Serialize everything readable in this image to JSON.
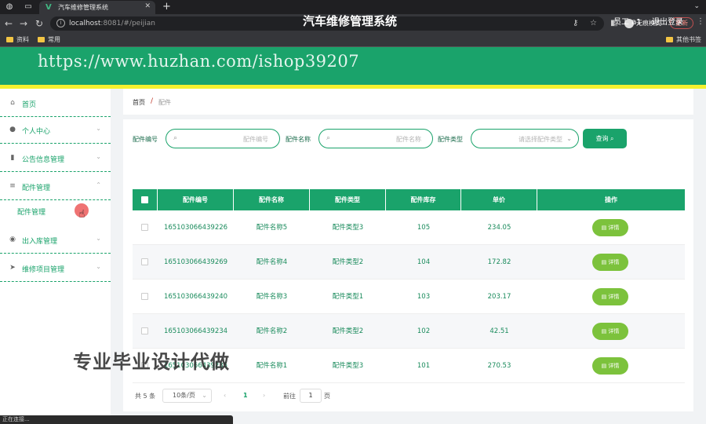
{
  "browser": {
    "tab_title": "汽车维修管理系统",
    "url_host": "localhost",
    "url_rest": ":8081/#/peijian",
    "profile_label": "无痕模式",
    "update_label": "更新",
    "bookmarks": [
      "资料",
      "常用",
      "其他书签"
    ]
  },
  "header": {
    "title": "汽车维修管理系统",
    "user": "员工 a1",
    "logout": "退出登录"
  },
  "sidebar": {
    "items": [
      {
        "label": "首页",
        "icon": "home-icon"
      },
      {
        "label": "个人中心",
        "icon": "user-icon"
      },
      {
        "label": "公告信息管理",
        "icon": "bar-chart-icon"
      },
      {
        "label": "配件管理",
        "icon": "sliders-icon"
      },
      {
        "label": "出入库管理",
        "icon": "location-icon"
      },
      {
        "label": "维修项目管理",
        "icon": "send-icon"
      }
    ],
    "sub_item": "配件管理"
  },
  "breadcrumb": {
    "home": "首页",
    "separator": "/",
    "current": "配件"
  },
  "search": {
    "fields": [
      {
        "label": "配件编号",
        "placeholder": "配件编号"
      },
      {
        "label": "配件名称",
        "placeholder": "配件名称"
      },
      {
        "label": "配件类型",
        "placeholder": "请选择配件类型"
      }
    ],
    "query_button": "查询"
  },
  "table": {
    "headers": [
      "配件编号",
      "配件名称",
      "配件类型",
      "配件库存",
      "单价",
      "操作"
    ],
    "rows": [
      {
        "id": "165103066439226",
        "name": "配件名称5",
        "type": "配件类型3",
        "stock": "105",
        "price": "234.05"
      },
      {
        "id": "165103066439269",
        "name": "配件名称4",
        "type": "配件类型2",
        "stock": "104",
        "price": "172.82"
      },
      {
        "id": "165103066439240",
        "name": "配件名称3",
        "type": "配件类型1",
        "stock": "103",
        "price": "203.17"
      },
      {
        "id": "165103066439234",
        "name": "配件名称2",
        "type": "配件类型2",
        "stock": "102",
        "price": "42.51"
      },
      {
        "id": "165103066439235",
        "name": "配件名称1",
        "type": "配件类型3",
        "stock": "101",
        "price": "270.53"
      }
    ],
    "action_label": "详情"
  },
  "pagination": {
    "total": "共 5 条",
    "page_size": "10条/页",
    "current_page": "1",
    "goto_label": "前往",
    "goto_value": "1",
    "page_suffix": "页"
  },
  "overlays": {
    "watermark_url": "https://www.huzhan.com/ishop39207",
    "watermark_text": "专业毕业设计代做",
    "status_text": "正在连接..."
  },
  "colors": {
    "primary": "#1aa36b",
    "accent_yellow": "#f4f12e",
    "detail_button": "#7cc23c"
  }
}
